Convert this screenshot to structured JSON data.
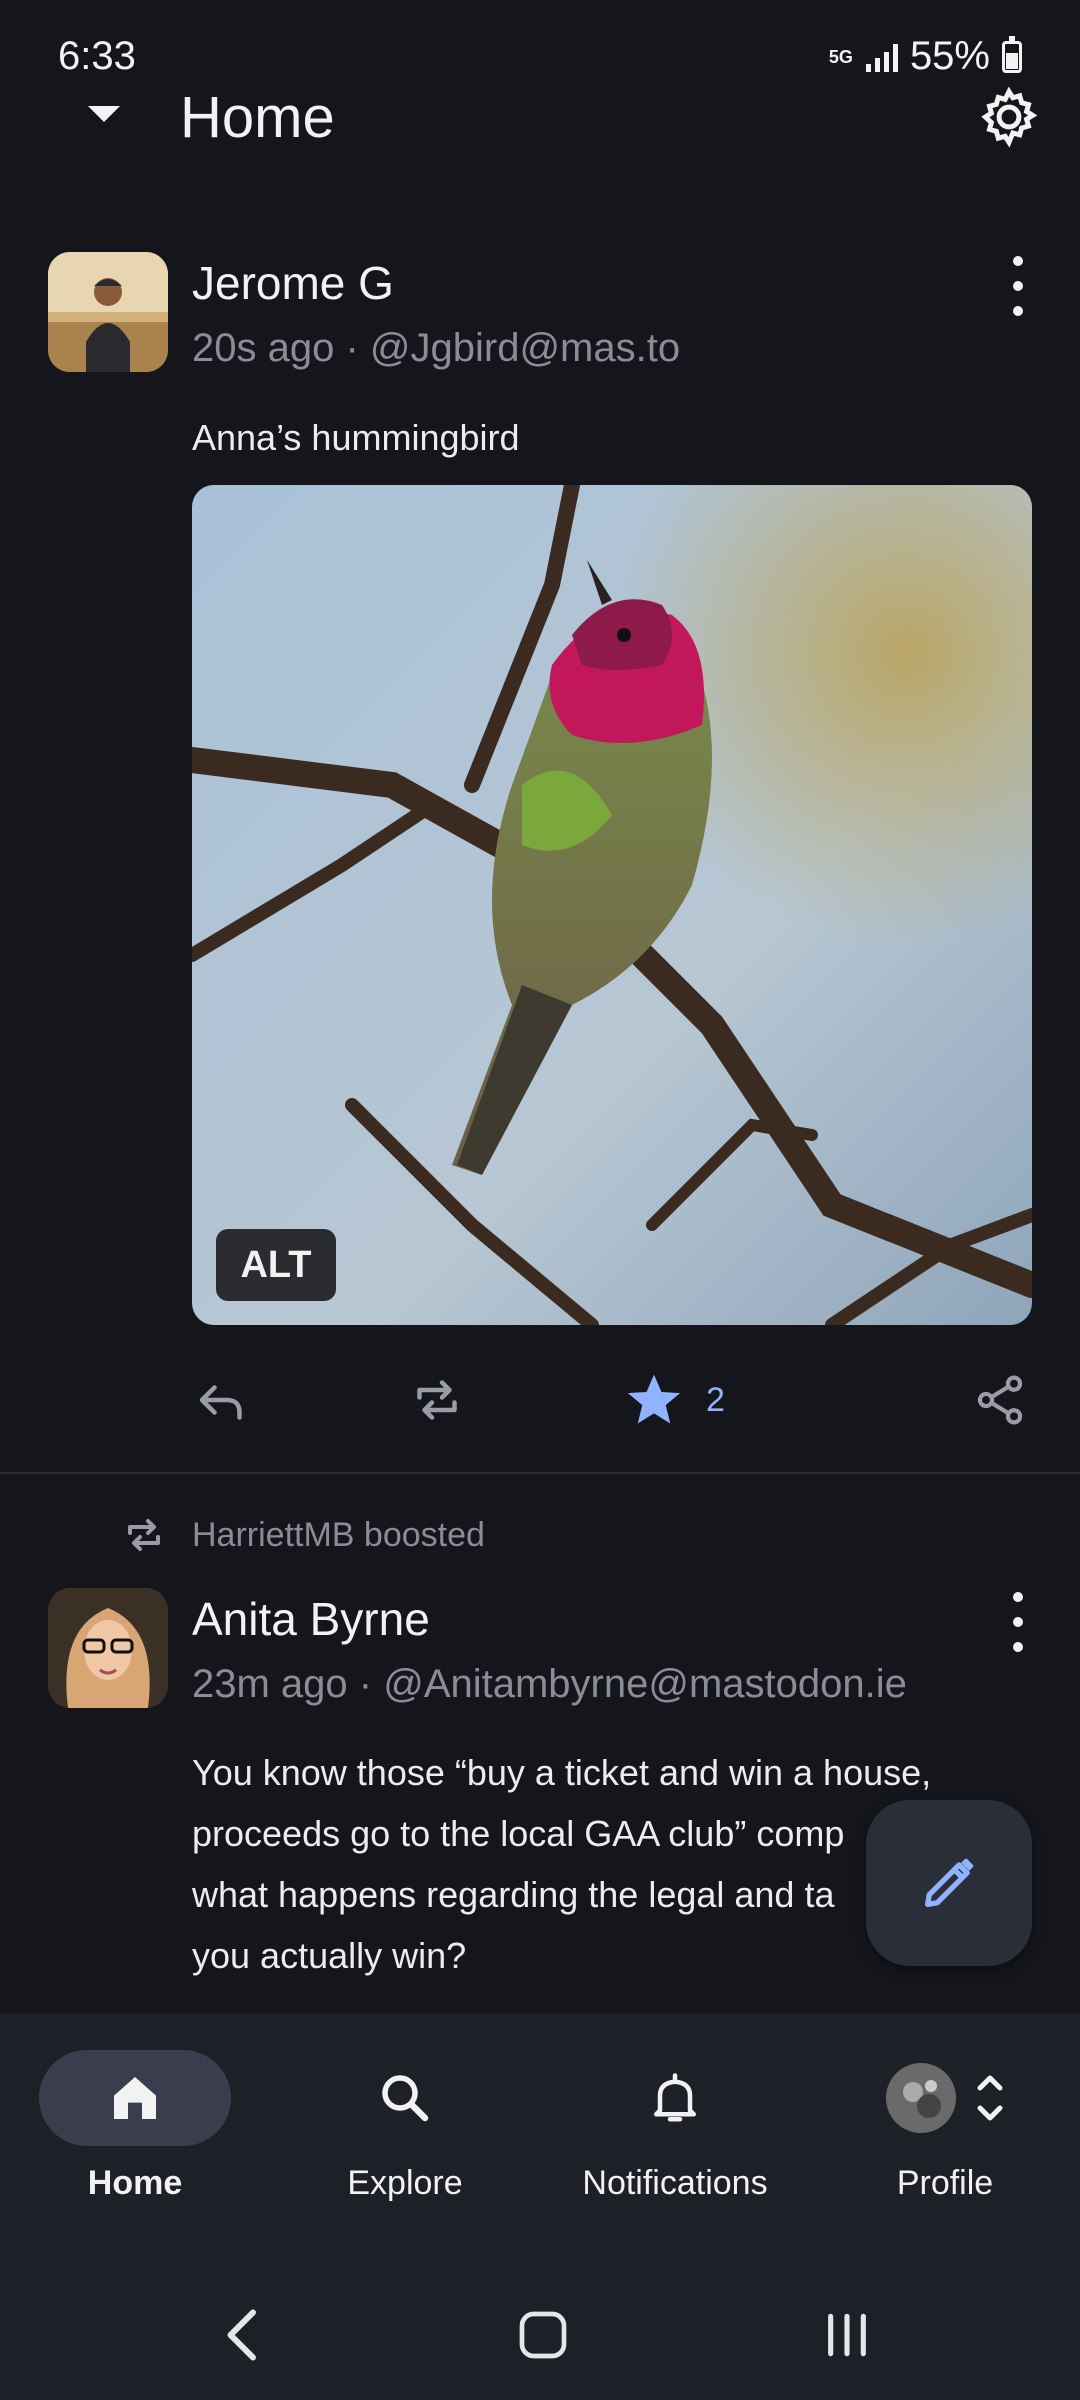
{
  "status_bar": {
    "time": "6:33",
    "network": "5G",
    "battery": "55%"
  },
  "header": {
    "title": "Home"
  },
  "posts": [
    {
      "author": "Jerome G",
      "meta": "20s ago · @Jgbird@mas.to",
      "text": "Anna’s hummingbird",
      "media_alt_badge": "ALT",
      "favourites": "2"
    },
    {
      "boosted_by": "HarriettMB boosted",
      "author": "Anita Byrne",
      "meta": "23m ago · @Anitambyrne@mastodon.ie",
      "text_lines": [
        "You know those “buy a ticket and win a house,",
        "proceeds go to the local GAA club” comp",
        "what happens regarding the legal and ta",
        "you actually win?"
      ]
    }
  ],
  "bottom_nav": {
    "items": [
      {
        "label": "Home",
        "icon": "home-icon",
        "active": true
      },
      {
        "label": "Explore",
        "icon": "search-icon",
        "active": false
      },
      {
        "label": "Notifications",
        "icon": "bell-icon",
        "active": false
      },
      {
        "label": "Profile",
        "icon": "avatar",
        "active": false
      }
    ]
  },
  "colors": {
    "background": "#15161b",
    "accent": "#8fb3ff",
    "nav_background": "#1e2027"
  }
}
